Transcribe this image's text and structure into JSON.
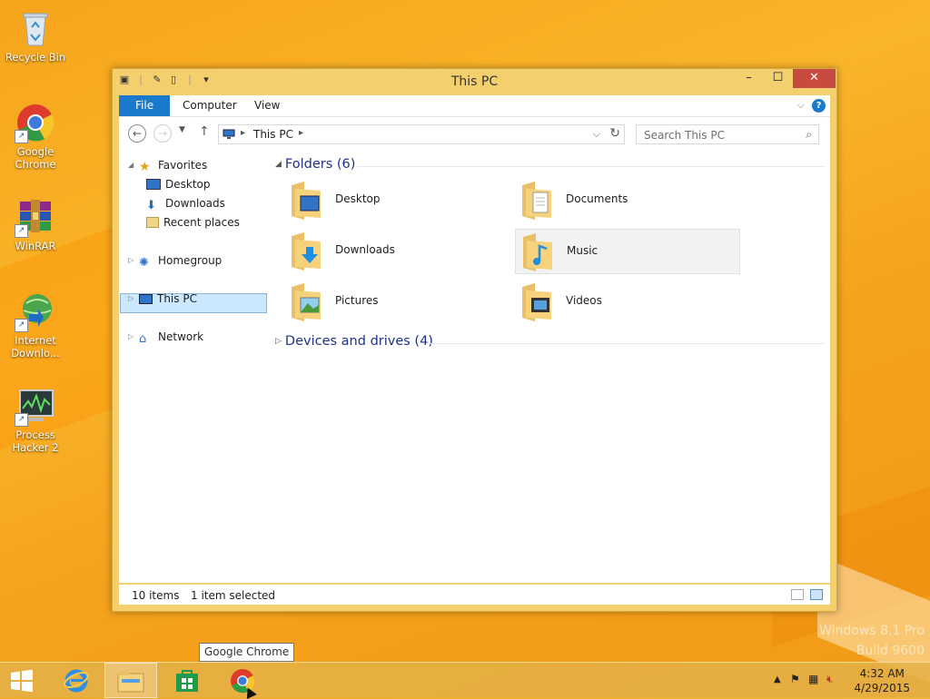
{
  "desktop": {
    "icons": [
      {
        "name": "recycle-bin",
        "label": "Recycle Bin"
      },
      {
        "name": "google-chrome",
        "label": "Google\nChrome"
      },
      {
        "name": "winrar",
        "label": "WinRAR"
      },
      {
        "name": "internet-download-manager",
        "label": "Internet\nDownlo..."
      },
      {
        "name": "process-hacker",
        "label": "Process\nHacker 2"
      }
    ],
    "watermark_line1": "Windows 8.1 Pro",
    "watermark_line2": "Build 9600"
  },
  "window": {
    "title": "This PC",
    "ribbon_tabs": [
      "File",
      "Computer",
      "View"
    ],
    "address_crumb": "This PC",
    "search_placeholder": "Search This PC"
  },
  "nav_pane": {
    "favorites": "Favorites",
    "favorites_items": [
      "Desktop",
      "Downloads",
      "Recent places"
    ],
    "homegroup": "Homegroup",
    "this_pc": "This PC",
    "network": "Network"
  },
  "main": {
    "folders_group": "Folders (6)",
    "folders": [
      "Desktop",
      "Documents",
      "Downloads",
      "Music",
      "Pictures",
      "Videos"
    ],
    "selected_folder": "Music",
    "devices_group": "Devices and drives (4)"
  },
  "status": {
    "items": "10 items",
    "selected": "1 item selected"
  },
  "taskbar": {
    "tooltip": "Google Chrome",
    "time": "4:32 AM",
    "date": "4/29/2015"
  },
  "colors": {
    "accent": "#1979ca",
    "wallpaper": "#f6a51b",
    "frame": "#f3cf6e",
    "close": "#c74b3f"
  }
}
